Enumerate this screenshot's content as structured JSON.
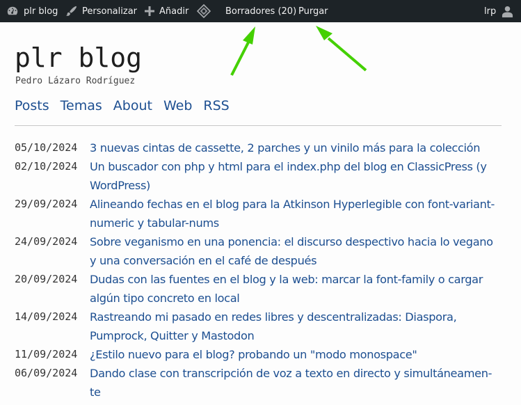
{
  "adminbar": {
    "site_name": "plr blog",
    "customize": "Personalizar",
    "add_new": "Añadir",
    "drafts": "Borradores (20)",
    "purge": "Purgar",
    "user": "lrp"
  },
  "site": {
    "title": "plr blog",
    "description": "Pedro Lázaro Rodríguez"
  },
  "nav": [
    {
      "label": "Posts"
    },
    {
      "label": "Temas"
    },
    {
      "label": "About"
    },
    {
      "label": "Web"
    },
    {
      "label": "RSS"
    }
  ],
  "posts": [
    {
      "date": "05/10/2024",
      "title": "3 nuevas cintas de cassette, 2 parches y un vinilo más para la colección"
    },
    {
      "date": "02/10/2024",
      "title": "Un buscador con php y html para el index.php del blog en ClassicPress (y WordPress)"
    },
    {
      "date": "29/09/2024",
      "title": "Alineando fechas en el blog para la Atkinson Hyperlegible con font-variant-numeric y tabular-nums"
    },
    {
      "date": "24/09/2024",
      "title": "Sobre veganismo en una ponencia: el discurso despectivo hacia lo vegano y una conversación en el café de después"
    },
    {
      "date": "20/09/2024",
      "title": "Dudas con las fuentes en el blog y la web: marcar la font-family o cargar algún tipo concreto en local"
    },
    {
      "date": "14/09/2024",
      "title": "Rastreando mi pasado en redes libres y descentralizadas: Diaspora, Pumprock, Quitter y Mastodon"
    },
    {
      "date": "11/09/2024",
      "title": "¿Estilo nuevo para el blog? probando un \"modo monospace\""
    },
    {
      "date": "06/09/2024",
      "title": "Dando clase con transcripción de voz a texto en directo y simultáneamen-te"
    }
  ],
  "colors": {
    "adminbar_bg": "#1d2327",
    "link": "#1d4f91",
    "annotation_arrow": "#44d000"
  }
}
